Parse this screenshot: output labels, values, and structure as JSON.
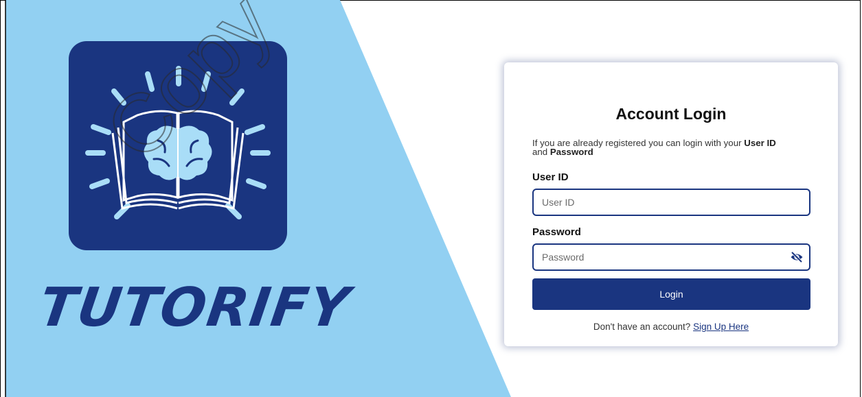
{
  "brand": {
    "name": "TUTORIFY",
    "logo_icon": "book-brain-icon"
  },
  "watermark": {
    "text": "Copy"
  },
  "login": {
    "title": "Account Login",
    "description_prefix": "If you are already registered you can login with your ",
    "description_user_id": "User ID",
    "description_and": " and ",
    "description_password": "Password",
    "user_id_label": "User ID",
    "user_id_placeholder": "User ID",
    "password_label": "Password",
    "password_placeholder": "Password",
    "toggle_visibility_icon": "eye-slash-icon",
    "login_button": "Login",
    "signup_prompt": "Don't have an account? ",
    "signup_link": "Sign Up Here"
  },
  "colors": {
    "primary": "#1a3580",
    "background_panel": "#92d0f2",
    "logo_light": "#a9ddf7"
  }
}
